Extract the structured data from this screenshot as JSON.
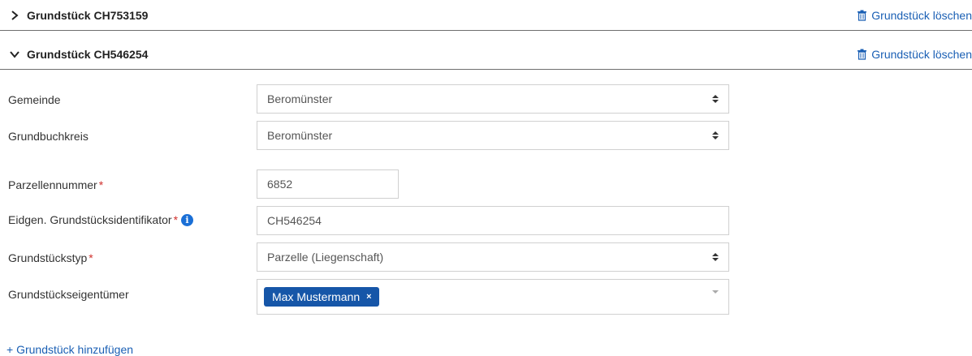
{
  "sections": [
    {
      "title": "Grundstück CH753159",
      "delete_label": "Grundstück löschen",
      "expanded": false
    },
    {
      "title": "Grundstück CH546254",
      "delete_label": "Grundstück löschen",
      "expanded": true
    }
  ],
  "form": {
    "gemeinde": {
      "label": "Gemeinde",
      "value": "Beromünster"
    },
    "grundbuchkreis": {
      "label": "Grundbuchkreis",
      "value": "Beromünster"
    },
    "parzellennummer": {
      "label": "Parzellennummer",
      "required_mark": "*",
      "value": "6852"
    },
    "egrid": {
      "label": "Eidgen. Grundstücksidentifikator",
      "required_mark": "*",
      "info_icon": "i",
      "value": "CH546254"
    },
    "typ": {
      "label": "Grundstückstyp",
      "required_mark": "*",
      "value": "Parzelle (Liegenschaft)"
    },
    "eigentuemer": {
      "label": "Grundstückseigentümer",
      "tags": [
        {
          "label": "Max Mustermann",
          "remove": "×"
        }
      ]
    }
  },
  "add_label": "+ Grundstück hinzufügen",
  "colors": {
    "link": "#1a5fb4",
    "tag": "#1656a8",
    "required": "#d0312d",
    "info": "#1a6fd6"
  }
}
